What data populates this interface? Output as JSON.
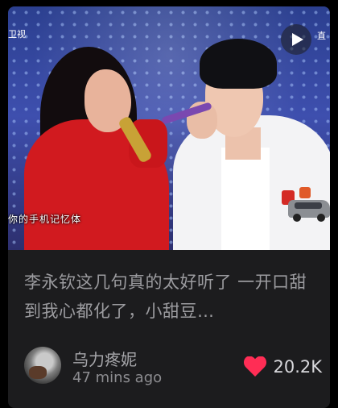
{
  "media": {
    "tv_logo": "卫视",
    "caption": "你的手机记忆体",
    "corner_text": "直",
    "play_icon": "play-icon"
  },
  "post": {
    "title": "李永钦这几句真的太好听了 一开口甜到我心都化了，小甜豆…",
    "author": "乌力疼妮",
    "time_ago": "47 mins ago",
    "likes": "20.2K",
    "like_icon": "heart-icon"
  },
  "colors": {
    "background": "#000000",
    "card": "#1c1c1e",
    "heart": "#ff2d55"
  }
}
